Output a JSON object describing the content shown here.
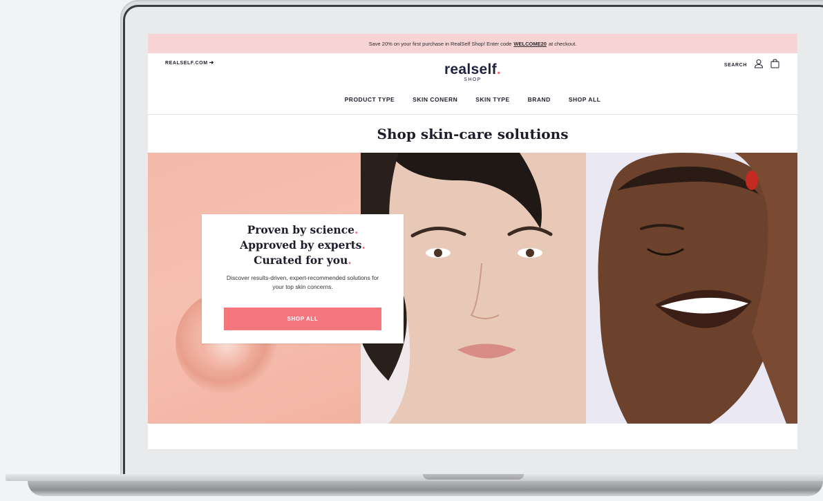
{
  "promo_bar": {
    "text_before": "Save 20% on your first purchase in RealSelf Shop! Enter code",
    "code": "WELCOME20",
    "text_after": "at checkout."
  },
  "header": {
    "realself_link": "REALSELF.COM",
    "logo_text": "realself",
    "logo_dot": ".",
    "logo_sub": "SHOP",
    "search_label": "SEARCH"
  },
  "nav": {
    "items": [
      "PRODUCT TYPE",
      "SKIN CONERN",
      "SKIN TYPE",
      "BRAND",
      "SHOP ALL"
    ]
  },
  "page": {
    "title": "Shop skin-care solutions"
  },
  "hero_card": {
    "line1": "Proven by science",
    "line2": "Approved by experts",
    "line3": "Curated for you",
    "dot": ".",
    "description": "Discover results-driven, expert-recommended solutions for your top skin concerns.",
    "button_label": "SHOP ALL"
  },
  "colors": {
    "promo_bg": "#f9d4d5",
    "accent": "#f06b73",
    "button": "#f6767d",
    "navy": "#1f2140"
  },
  "icons": {
    "arrow": "arrow-right-icon",
    "user": "user-icon",
    "bag": "shopping-bag-icon"
  }
}
